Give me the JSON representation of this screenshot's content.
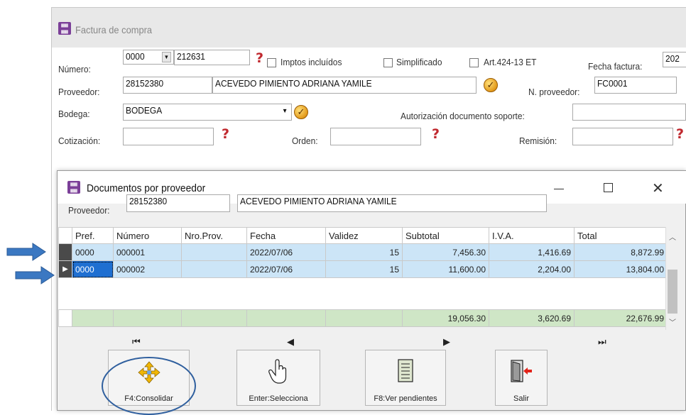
{
  "main_window": {
    "title": "Factura de compra",
    "numero_label": "Número:",
    "numero_prefix": "0000",
    "numero_value": "212631",
    "imptos_label": "Imptos incluídos",
    "simplificado_label": "Simplificado",
    "art_label": "Art.424-13 ET",
    "fecha_factura_label": "Fecha factura:",
    "fecha_factura_value": "202",
    "proveedor_label": "Proveedor:",
    "proveedor_id": "28152380",
    "proveedor_name": "ACEVEDO PIMIENTO ADRIANA YAMILE",
    "n_proveedor_label": "N. proveedor:",
    "n_proveedor_value": "FC0001",
    "bodega_label": "Bodega:",
    "bodega_value": "BODEGA",
    "autorizacion_label": "Autorización documento soporte:",
    "cotizacion_label": "Cotización:",
    "orden_label": "Orden:",
    "remision_label": "Remisión:",
    "qmark": "?"
  },
  "dialog": {
    "title": "Documentos por proveedor",
    "proveedor_label": "Proveedor:",
    "proveedor_id": "28152380",
    "proveedor_name": "ACEVEDO PIMIENTO ADRIANA YAMILE",
    "columns": [
      "Pref.",
      "Número",
      "Nro.Prov.",
      "Fecha",
      "Validez",
      "Subtotal",
      "I.V.A.",
      "Total"
    ],
    "rows": [
      {
        "pref": "0000",
        "numero": "000001",
        "nro_prov": "",
        "fecha": "2022/07/06",
        "validez": "15",
        "subtotal": "7,456.30",
        "iva": "1,416.69",
        "total": "8,872.99"
      },
      {
        "pref": "0000",
        "numero": "000002",
        "nro_prov": "",
        "fecha": "2022/07/06",
        "validez": "15",
        "subtotal": "11,600.00",
        "iva": "2,204.00",
        "total": "13,804.00"
      }
    ],
    "totals": {
      "subtotal": "19,056.30",
      "iva": "3,620.69",
      "total": "22,676.99"
    },
    "nav": {
      "first": "⏮",
      "prev": "◀",
      "next": "▶",
      "last": "⏭"
    },
    "buttons": {
      "consolidar": "F4:Consolidar",
      "selecciona": "Enter:Selecciona",
      "pendientes": "F8:Ver pendientes",
      "salir": "Salir"
    }
  },
  "colors": {
    "selected_row": "#cce5f7",
    "totals_row": "#cfe6c6",
    "annotation_arrow": "#3b78c2",
    "annotation_circle": "#2f5f9e"
  }
}
